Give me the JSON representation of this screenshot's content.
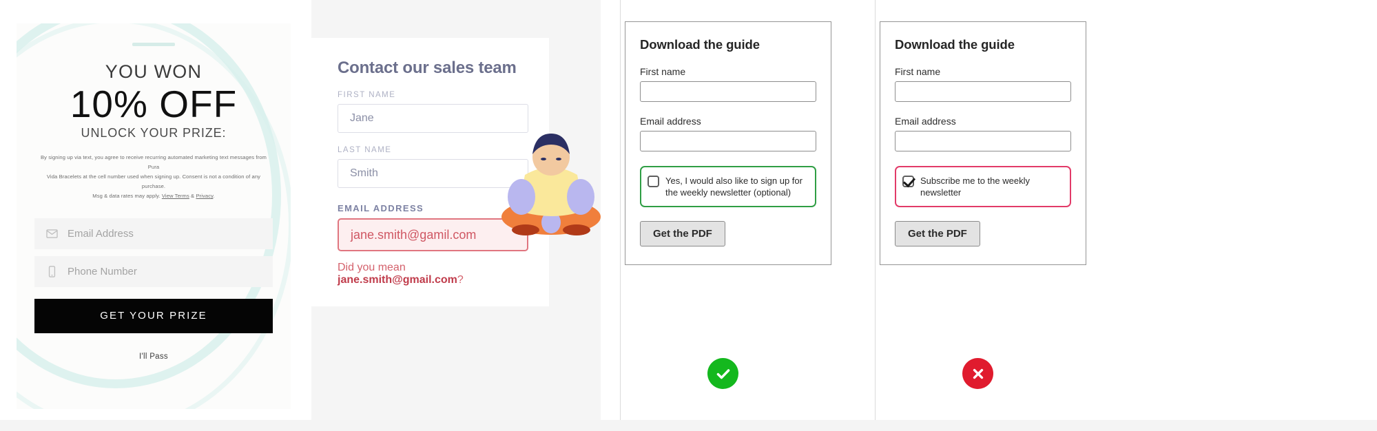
{
  "panels": {
    "coupon": {
      "name": "exit-intent-coupon-popup",
      "eyebrow": "YOU WON",
      "headline": "10% OFF",
      "subhead": "UNLOCK YOUR PRIZE:",
      "fineprint_lines": [
        "By signing up via text, you agree to receive recurring automated marketing text messages from Pura",
        "Vida Bracelets at the cell number used when signing up. Consent is not a condition of any purchase.",
        "Msg & data rates may apply."
      ],
      "fineprint_tail": {
        "before": "Msg & data rates may apply. ",
        "link_terms": "View Terms",
        "amp": " & ",
        "link_privacy": "Privacy",
        "after": "."
      },
      "fields": [
        {
          "icon": "envelope-icon",
          "placeholder": "Email Address",
          "value": ""
        },
        {
          "icon": "mobile-phone-icon",
          "placeholder": "Phone Number",
          "value": ""
        }
      ],
      "submit_label": "GET YOUR PRIZE",
      "dismiss_label": "I'll Pass",
      "colors": {
        "button_bg": "#050505",
        "arc": "#d8f0ec"
      }
    },
    "contact": {
      "name": "contact-sales-form",
      "title": "Contact our sales team",
      "fields": [
        {
          "label": "FIRST NAME",
          "value": "Jane",
          "state": "normal"
        },
        {
          "label": "LAST NAME",
          "value": "Smith",
          "state": "normal"
        },
        {
          "label": "EMAIL ADDRESS",
          "value": "jane.smith@gamil.com",
          "state": "error"
        }
      ],
      "suggestion": {
        "prefix": "Did you mean ",
        "email": "jane.smith@gmail.com",
        "suffix": "?"
      },
      "colors": {
        "title": "#6b6f8c",
        "error_border": "#e0757f",
        "error_bg": "#fdeff0",
        "error_text": "#cf5763"
      }
    },
    "guide_good": {
      "name": "download-guide-form-good",
      "title": "Download the guide",
      "fields": [
        {
          "label": "First name",
          "value": ""
        },
        {
          "label": "Email address",
          "value": ""
        }
      ],
      "checkbox": {
        "label": "Yes, I would also like to sign up for the weekly newsletter (optional)",
        "checked": false,
        "highlight_color": "#2f9e44"
      },
      "submit_label": "Get the PDF",
      "verdict": "check-circle-icon"
    },
    "guide_bad": {
      "name": "download-guide-form-bad",
      "title": "Download the guide",
      "fields": [
        {
          "label": "First name",
          "value": ""
        },
        {
          "label": "Email address",
          "value": ""
        }
      ],
      "checkbox": {
        "label": "Subscribe me to the weekly newsletter",
        "checked": true,
        "highlight_color": "#e23a68"
      },
      "submit_label": "Get the PDF",
      "verdict": "cross-circle-icon"
    }
  }
}
